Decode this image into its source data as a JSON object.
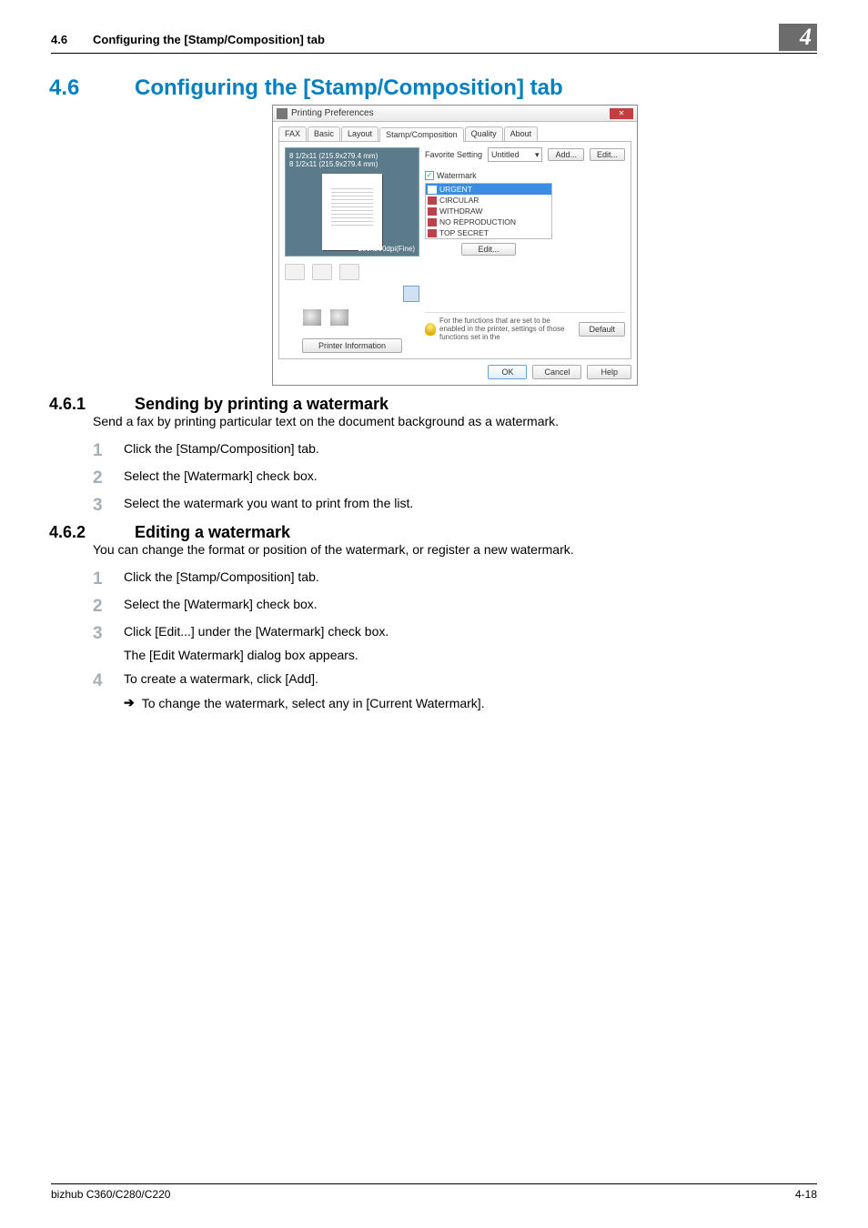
{
  "header": {
    "section_num": "4.6",
    "section_title": "Configuring the [Stamp/Composition] tab",
    "chapter_badge": "4"
  },
  "h1": {
    "num": "4.6",
    "title": "Configuring the [Stamp/Composition] tab"
  },
  "sub1": {
    "num": "4.6.1",
    "title": "Sending by printing a watermark",
    "intro": "Send a fax by printing particular text on the document background as a watermark.",
    "steps": {
      "s1": "Click the [Stamp/Composition] tab.",
      "s2": "Select the [Watermark] check box.",
      "s3": "Select the watermark you want to print from the list."
    }
  },
  "sub2": {
    "num": "4.6.2",
    "title": "Editing a watermark",
    "intro": "You can change the format or position of the watermark, or register a new watermark.",
    "steps": {
      "s1": "Click the [Stamp/Composition] tab.",
      "s2": "Select the [Watermark] check box.",
      "s3a": "Click [Edit...] under the [Watermark] check box.",
      "s3b": "The [Edit Watermark] dialog box appears.",
      "s4a": "To create a watermark, click [Add].",
      "s4b": "To change the watermark, select any in [Current Watermark]."
    }
  },
  "footer": {
    "left": "bizhub C360/C280/C220",
    "right": "4-18"
  },
  "screenshot": {
    "window_title": "Printing Preferences",
    "tabs": {
      "t1": "FAX",
      "t2": "Basic",
      "t3": "Layout",
      "t4": "Stamp/Composition",
      "t5": "Quality",
      "t6": "About"
    },
    "preview": {
      "size1": "8 1/2x11 (215.9x279.4 mm)",
      "size2": "8 1/2x11 (215.9x279.4 mm)",
      "resolution": "200x200dpi(Fine)"
    },
    "favorite_label": "Favorite Setting",
    "favorite_value": "Untitled",
    "btn_add": "Add...",
    "btn_edit_fav": "Edit...",
    "watermark_label": "Watermark",
    "list": {
      "l1": "URGENT",
      "l2": "CIRCULAR",
      "l3": "WITHDRAW",
      "l4": "NO REPRODUCTION",
      "l5": "TOP SECRET"
    },
    "btn_edit": "Edit...",
    "btn_printer_info": "Printer Information",
    "info_text": "For the functions that are set to be enabled in the printer, settings of those functions set in the",
    "btn_default": "Default",
    "btn_ok": "OK",
    "btn_cancel": "Cancel",
    "btn_help": "Help"
  }
}
